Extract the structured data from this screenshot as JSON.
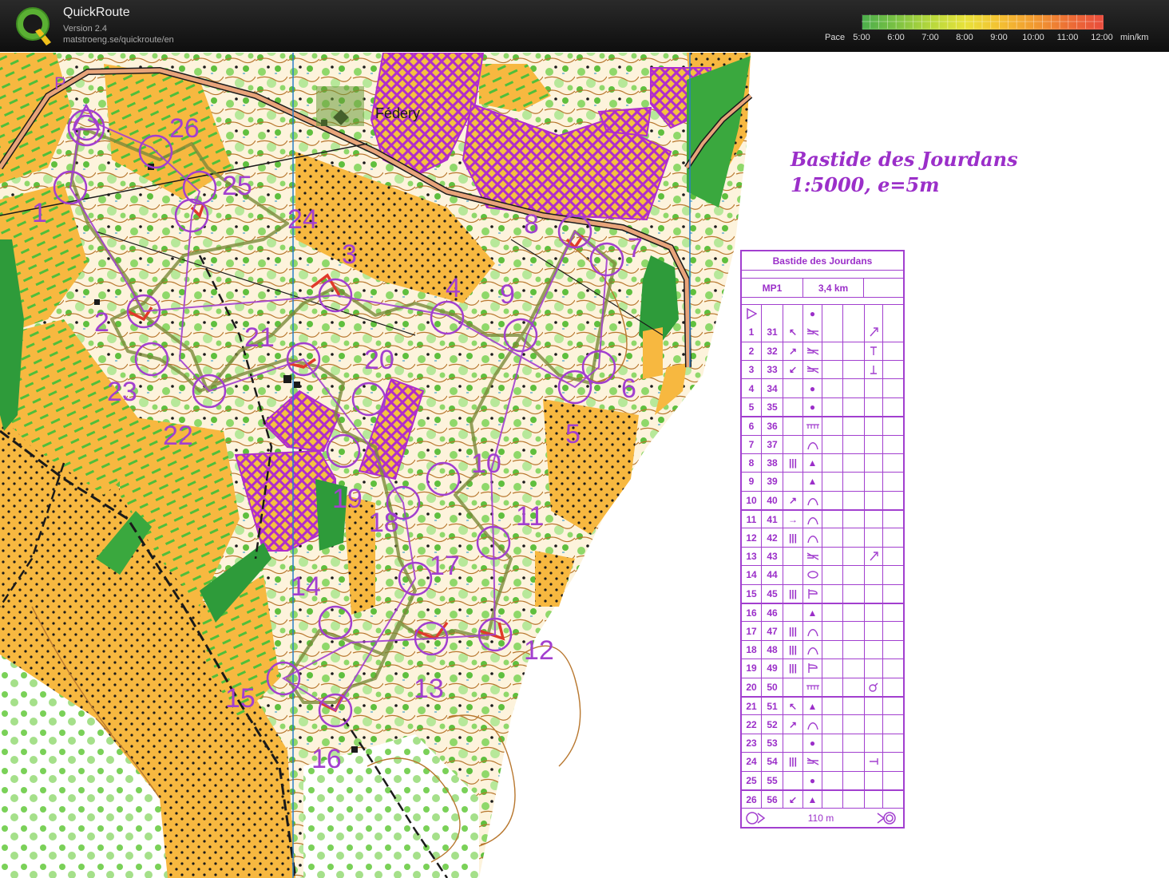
{
  "app": {
    "name": "QuickRoute",
    "version": "Version 2.4",
    "url": "matstroeng.se/quickroute/en",
    "logo_icon": "quickroute-q-logo-icon"
  },
  "pace_scale": {
    "label": "Pace",
    "ticks": [
      "5:00",
      "6:00",
      "7:00",
      "8:00",
      "9:00",
      "10:00",
      "11:00",
      "12:00"
    ],
    "unit": "min/km",
    "colors": [
      "#4cae4c",
      "#b7d83c",
      "#e8e23a",
      "#f19a30",
      "#e94b3c"
    ]
  },
  "map": {
    "title_line1": "Bastide des Jourdans",
    "title_line2": "1:5000, e=5m",
    "place_name": "Fédery",
    "parking_label": "P",
    "course_color": "#a23fcf",
    "route_color": "#8a9a4a",
    "control_labels": [
      "1",
      "2",
      "3",
      "4",
      "5",
      "6",
      "7",
      "8",
      "9",
      "10",
      "11",
      "12",
      "13",
      "14",
      "15",
      "16",
      "17",
      "18",
      "19",
      "20",
      "21",
      "22",
      "23",
      "24",
      "25",
      "26"
    ]
  },
  "description_sheet": {
    "title": "Bastide des Jourdans",
    "class_name": "MP1",
    "length": "3,4 km",
    "start_symbol": "start-triangle-icon",
    "start_feature": "●",
    "finish_distance": "110 m",
    "rows": [
      {
        "n": "1",
        "code": "31",
        "dir": "↖",
        "feature": "stony-ground",
        "loc": "ruined-wall-end"
      },
      {
        "n": "2",
        "code": "32",
        "dir": "↗",
        "feature": "stony-ground",
        "loc": "top"
      },
      {
        "n": "3",
        "code": "33",
        "dir": "↙",
        "feature": "stony-ground",
        "loc": "foot"
      },
      {
        "n": "4",
        "code": "34",
        "dir": "",
        "feature": "●",
        "loc": ""
      },
      {
        "n": "5",
        "code": "35",
        "dir": "",
        "feature": "●",
        "loc": ""
      },
      {
        "n": "6",
        "code": "36",
        "dir": "",
        "feature": "ruined-wall",
        "loc": ""
      },
      {
        "n": "7",
        "code": "37",
        "dir": "",
        "feature": "spur",
        "loc": ""
      },
      {
        "n": "8",
        "code": "38",
        "dir": "|||",
        "feature": "▲",
        "loc": ""
      },
      {
        "n": "9",
        "code": "39",
        "dir": "",
        "feature": "▲",
        "loc": ""
      },
      {
        "n": "10",
        "code": "40",
        "dir": "↗",
        "feature": "spur",
        "loc": ""
      },
      {
        "n": "11",
        "code": "41",
        "dir": "→",
        "feature": "spur",
        "loc": ""
      },
      {
        "n": "12",
        "code": "42",
        "dir": "|||",
        "feature": "spur",
        "loc": ""
      },
      {
        "n": "13",
        "code": "43",
        "dir": "",
        "feature": "stony-ground",
        "loc": "ruined-wall-end"
      },
      {
        "n": "14",
        "code": "44",
        "dir": "",
        "feature": "ellipse",
        "loc": ""
      },
      {
        "n": "15",
        "code": "45",
        "dir": "|||",
        "feature": "terrace",
        "loc": ""
      },
      {
        "n": "16",
        "code": "46",
        "dir": "",
        "feature": "▲",
        "loc": ""
      },
      {
        "n": "17",
        "code": "47",
        "dir": "|||",
        "feature": "spur",
        "loc": ""
      },
      {
        "n": "18",
        "code": "48",
        "dir": "|||",
        "feature": "spur",
        "loc": ""
      },
      {
        "n": "19",
        "code": "49",
        "dir": "|||",
        "feature": "terrace",
        "loc": ""
      },
      {
        "n": "20",
        "code": "50",
        "dir": "",
        "feature": "ruined-wall",
        "loc": "end"
      },
      {
        "n": "21",
        "code": "51",
        "dir": "↖",
        "feature": "▲",
        "loc": ""
      },
      {
        "n": "22",
        "code": "52",
        "dir": "↗",
        "feature": "spur",
        "loc": ""
      },
      {
        "n": "23",
        "code": "53",
        "dir": "",
        "feature": "●",
        "loc": ""
      },
      {
        "n": "24",
        "code": "54",
        "dir": "|||",
        "feature": "stony-ground",
        "loc": "side"
      },
      {
        "n": "25",
        "code": "55",
        "dir": "",
        "feature": "●",
        "loc": ""
      },
      {
        "n": "26",
        "code": "56",
        "dir": "↙",
        "feature": "▲",
        "loc": ""
      }
    ]
  }
}
